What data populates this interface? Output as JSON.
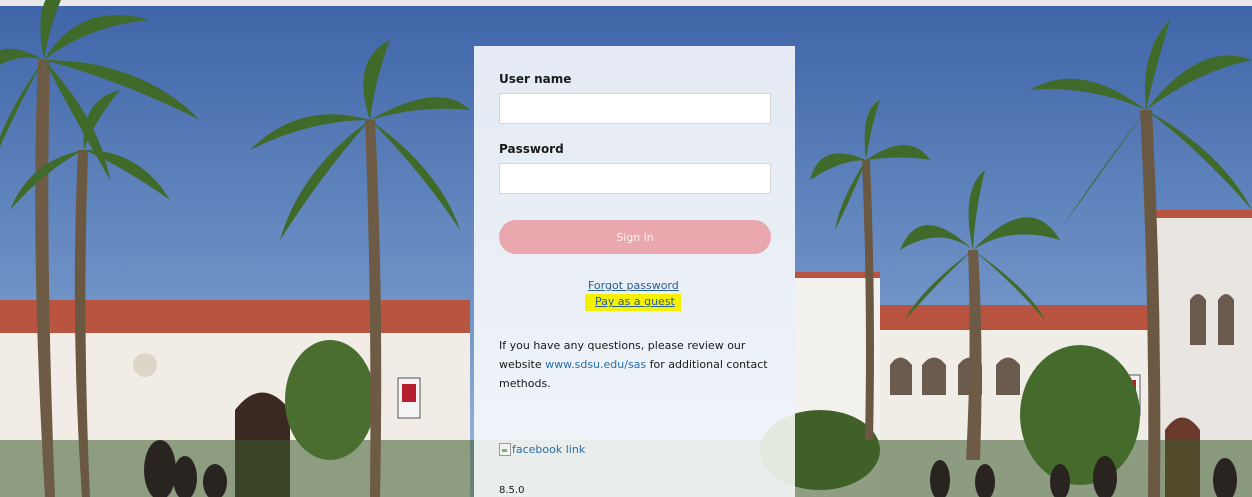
{
  "colors": {
    "sky": "#5b7fb0",
    "signin_button": "#e8a8ad",
    "link": "#2a5f8f",
    "highlight": "#f4f000"
  },
  "login": {
    "username_label": "User name",
    "username_value": "",
    "password_label": "Password",
    "password_value": "",
    "signin_label": "Sign in",
    "forgot_password": "Forgot password",
    "pay_as_guest": "Pay as a guest",
    "info_text_before": "If you have any questions, please review our website ",
    "info_link": "www.sdsu.edu/sas",
    "info_text_after": " for additional contact methods.",
    "facebook_alt": "facebook link",
    "version": "8.5.0"
  },
  "icons": {
    "facebook": "broken-image-icon"
  }
}
